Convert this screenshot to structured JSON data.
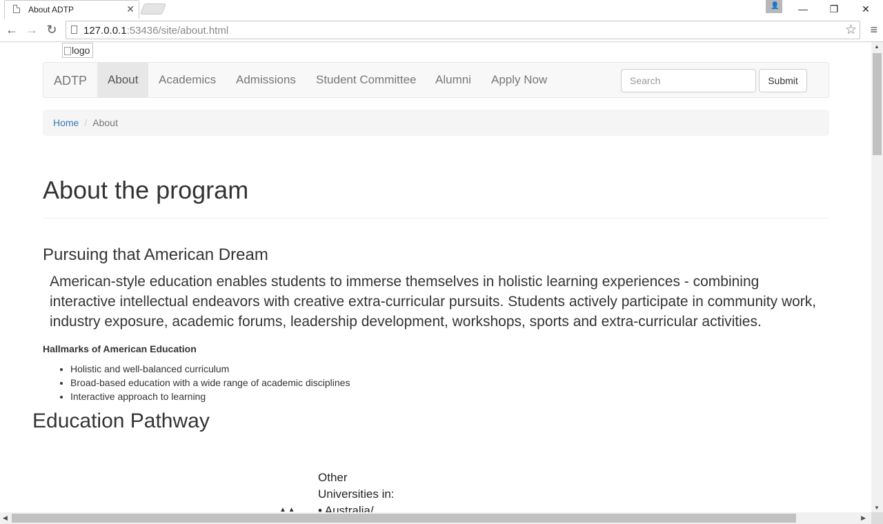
{
  "browser": {
    "tab_title": "About ADTP",
    "url_host": "127.0.0.1",
    "url_rest": ":53436/site/about.html",
    "icons": [
      "page-icon",
      "close-icon",
      "back-arrow-icon",
      "forward-arrow-icon",
      "reload-icon",
      "star-icon",
      "menu-icon",
      "profile-icon",
      "minimize-icon",
      "restore-icon",
      "window-close-icon"
    ]
  },
  "page": {
    "logo_alt": "logo",
    "navbar": {
      "brand": "ADTP",
      "links": [
        "About",
        "Academics",
        "Admissions",
        "Student Committee",
        "Alumni",
        "Apply Now"
      ],
      "active": "About",
      "search_placeholder": "Search",
      "submit_label": "Submit"
    },
    "breadcrumb": {
      "home": "Home",
      "current": "About"
    },
    "title": "About the program",
    "subtitle": "Pursuing that American Dream",
    "lead": "American-style education enables students to immerse themselves in holistic learning experiences - combining interactive intellectual endeavors with creative extra-curricular pursuits. Students actively participate in community work, industry exposure, academic forums, leadership development, workshops, sports and extra-curricular activities.",
    "hallmarks": {
      "title": "Hallmarks of American Education",
      "items": [
        "Holistic and well-balanced curriculum",
        "Broad-based education with a wide range of academic disciplines",
        "Interactive approach to learning"
      ]
    },
    "pathway_title": "Education Pathway",
    "diagram": {
      "line1": "Other",
      "line2": "Universities in:",
      "line3": "• Australia/"
    }
  },
  "colors": {
    "link": "#337ab7",
    "navbar_bg": "#f8f8f8",
    "active_bg": "#e7e7e7"
  }
}
